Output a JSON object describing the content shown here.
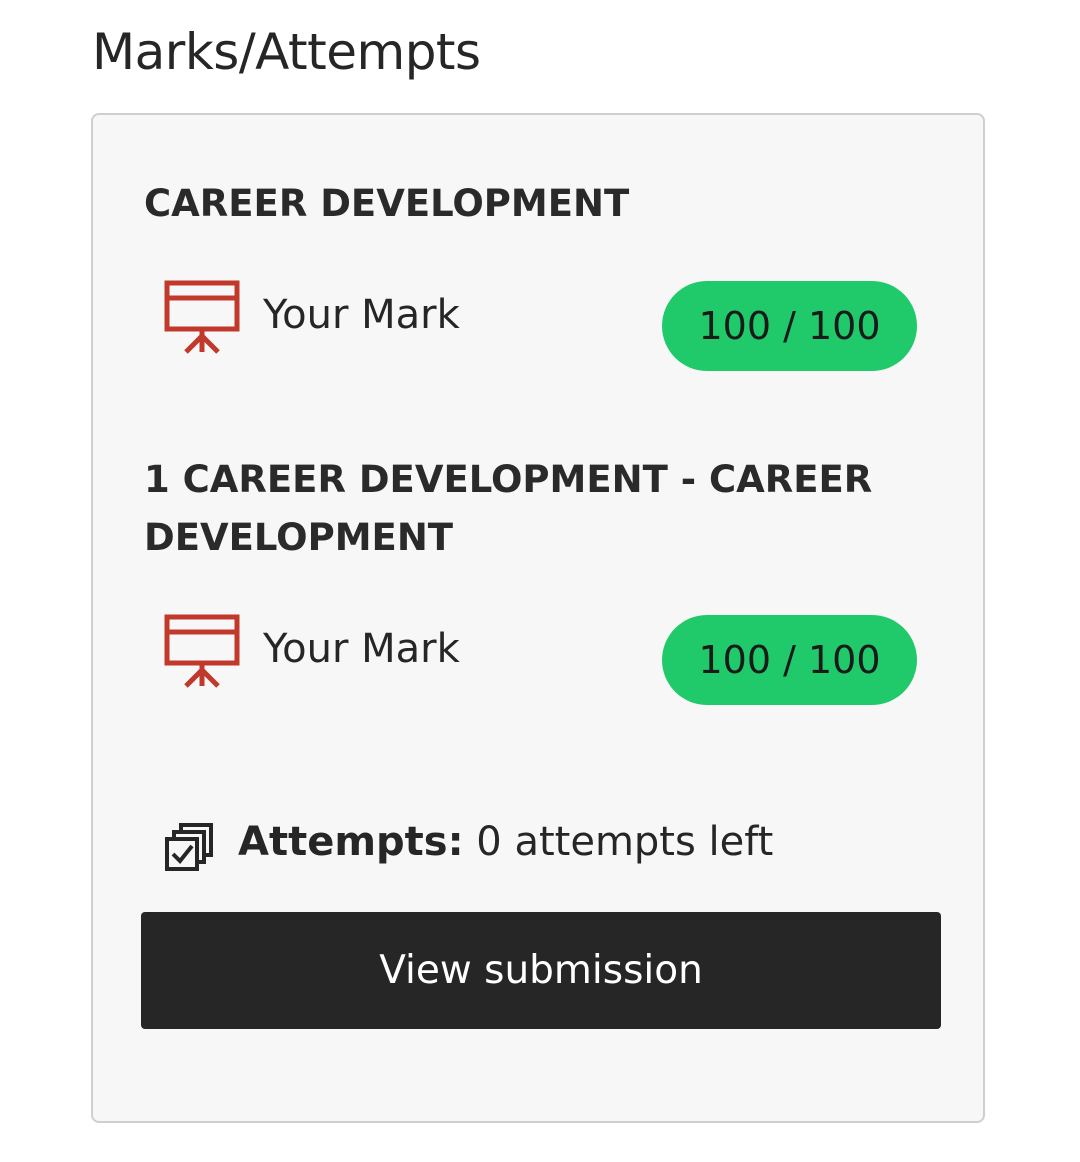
{
  "page": {
    "title": "Marks/Attempts"
  },
  "sections": [
    {
      "title": "CAREER DEVELOPMENT",
      "mark_label": "Your Mark",
      "mark_icon": "presentation-board-icon",
      "grade": "100 / 100"
    },
    {
      "title_line1": "1 CAREER DEVELOPMENT - CAREER",
      "title_line2": "DEVELOPMENT",
      "mark_label": "Your Mark",
      "mark_icon": "presentation-board-icon",
      "grade": "100 / 100"
    }
  ],
  "attempts": {
    "icon": "copy-checkbox-icon",
    "label": "Attempts:",
    "value": "0 attempts left"
  },
  "button": {
    "label": "View submission"
  },
  "colors": {
    "grade_pill": "#20c96a",
    "icon_red": "#c0392b",
    "button_bg": "#262626",
    "card_bg": "#f7f7f7"
  }
}
